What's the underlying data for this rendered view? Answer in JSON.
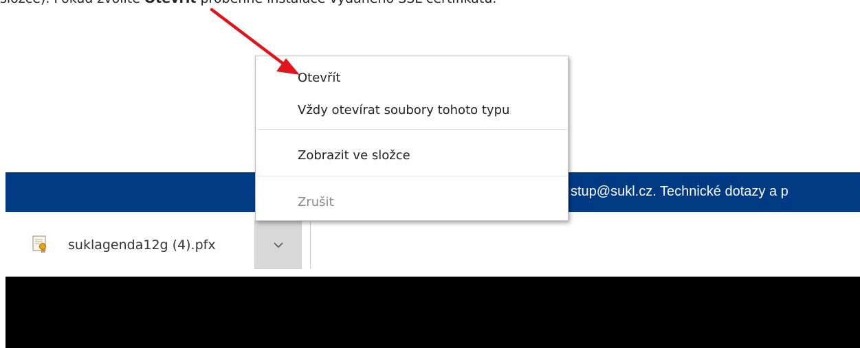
{
  "instruction": {
    "before": "složce). Pokud zvolíte ",
    "bold": "Otevřít",
    "after": " proběhne instalace vydaného SSL certifikátu."
  },
  "banner": {
    "text": "stup@sukl.cz. Technické dotazy a p"
  },
  "download": {
    "file_name": "suklagenda12g (4).pfx",
    "file_icon": "certificate-file-icon",
    "menu_button_icon": "chevron-down-icon"
  },
  "context_menu": {
    "items": [
      {
        "label": "Otevřít",
        "disabled": false
      },
      {
        "label": "Vždy otevírat soubory tohoto typu",
        "disabled": false
      },
      {
        "label": "Zobrazit ve složce",
        "disabled": false
      },
      {
        "label": "Zrušit",
        "disabled": true
      }
    ]
  },
  "colors": {
    "banner": "#003a85",
    "arrow": "#e0151b",
    "disabled_text": "#8a8a8a"
  }
}
